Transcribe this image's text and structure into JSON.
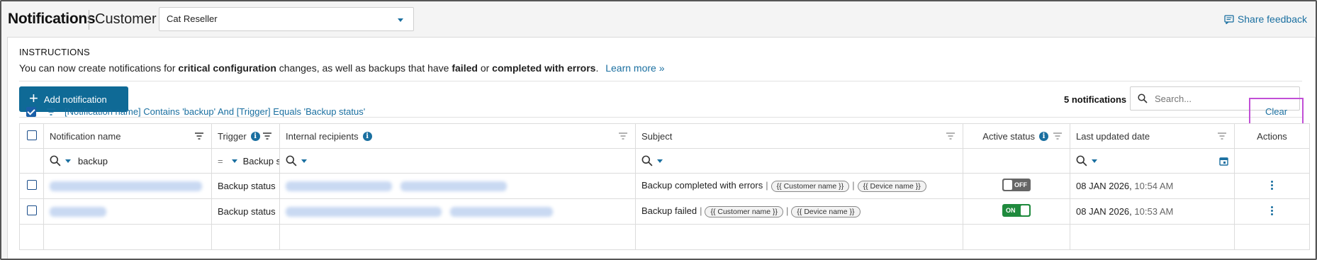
{
  "header": {
    "title": "Notifications",
    "customer_label": "Customer",
    "customer_value": "Cat Reseller",
    "feedback_label": "Share feedback"
  },
  "instructions": {
    "title": "INSTRUCTIONS",
    "text_1": "You can now create notifications for ",
    "bold_1": "critical configuration",
    "text_2": " changes, as well as backups that have ",
    "bold_2": "failed",
    "text_3": " or ",
    "bold_3": "completed with errors",
    "text_4": ".",
    "learn_more": "Learn more »"
  },
  "toolbar": {
    "add_label": "Add notification",
    "count_label": "5 notifications",
    "search_placeholder": "Search..."
  },
  "filter": {
    "text": "[Notification name] Contains 'backup' And [Trigger] Equals 'Backup status'",
    "clear_label": "Clear"
  },
  "table": {
    "columns": {
      "name": "Notification name",
      "trigger": "Trigger",
      "recipients": "Internal recipients",
      "subject": "Subject",
      "active": "Active status",
      "updated": "Last updated date",
      "actions": "Actions"
    },
    "filters": {
      "name_value": "backup",
      "trigger_op": "=",
      "trigger_value": "Backup s"
    },
    "rows": [
      {
        "trigger": "Backup status",
        "subject_text": "Backup completed with errors",
        "tag_1": "{{ Customer name }}",
        "tag_2": "{{ Device name }}",
        "status": "OFF",
        "date": "08 JAN 2026,",
        "time": "10:54 AM"
      },
      {
        "trigger": "Backup status",
        "subject_text": "Backup failed",
        "tag_1": "{{ Customer name }}",
        "tag_2": "{{ Device name }}",
        "status": "ON",
        "date": "08 JAN 2026,",
        "time": "10:53 AM"
      }
    ]
  },
  "colors": {
    "accent": "#1a6fa0",
    "primary_button": "#0f6a96",
    "toggle_on": "#1f8a3d",
    "toggle_off": "#666666",
    "highlight": "#c14fd6"
  }
}
